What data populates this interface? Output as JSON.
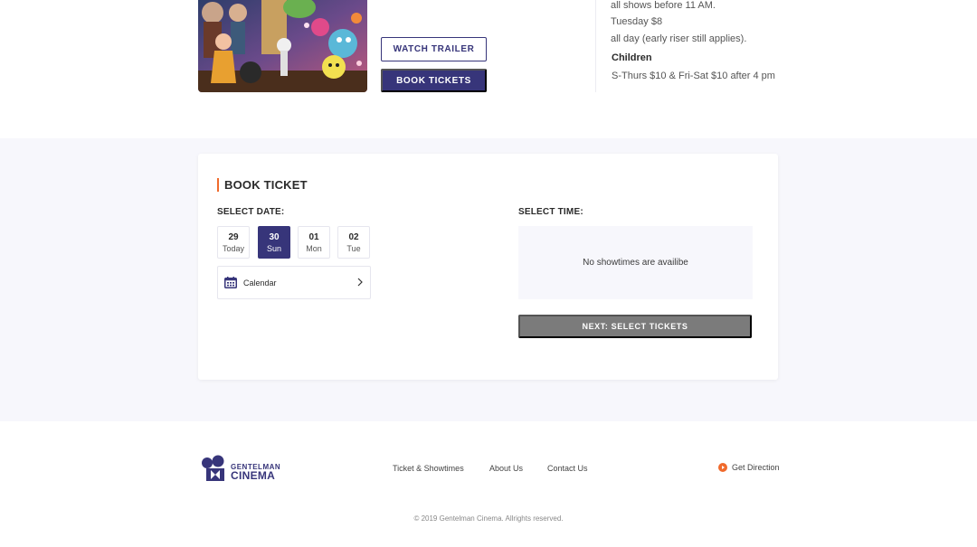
{
  "movie": {
    "watch_trailer": "WATCH TRAILER",
    "book_tickets": "BOOK TICKETS"
  },
  "pricing": {
    "line1": "all shows before 11 AM.",
    "line2": "Tuesday $8",
    "line3": "all day (early riser still applies).",
    "children_heading": "Children",
    "children_line": "S-Thurs $10 & Fri-Sat $10 after 4 pm"
  },
  "booking": {
    "title": "BOOK TICKET",
    "select_date_label": "SELECT DATE:",
    "select_time_label": "SELECT TIME:",
    "dates": [
      {
        "num": "29",
        "day": "Today",
        "active": false
      },
      {
        "num": "30",
        "day": "Sun",
        "active": true
      },
      {
        "num": "01",
        "day": "Mon",
        "active": false
      },
      {
        "num": "02",
        "day": "Tue",
        "active": false
      }
    ],
    "calendar_label": "Calendar",
    "no_showtimes": "No showtimes are availibe",
    "next_button": "NEXT: SELECT TICKETS"
  },
  "footer": {
    "logo_line1": "GENTELMAN",
    "logo_line2": "CINEMA",
    "links": [
      "Ticket & Showtimes",
      "About Us",
      "Contact Us"
    ],
    "get_direction": "Get Direction",
    "copyright": "© 2019 Gentelman Cinema. Allrights reserved."
  },
  "colors": {
    "brand": "#37357a",
    "accent": "#f06a2c",
    "disabled_button": "#7b7b7b",
    "section_bg": "#f7f7fc"
  }
}
